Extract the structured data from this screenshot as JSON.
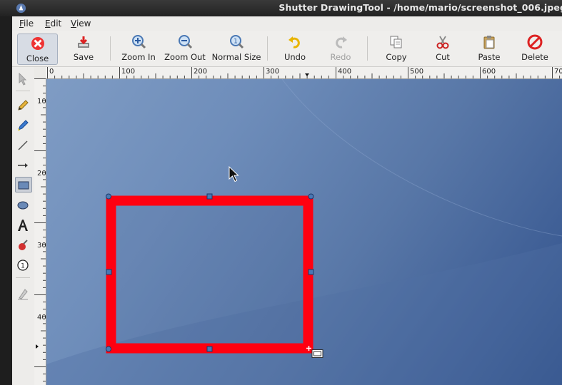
{
  "window": {
    "title": "Shutter DrawingTool - /home/mario/screenshot_006.jpeg"
  },
  "menubar": [
    {
      "label": "File",
      "mnemonic": "F",
      "rest": "ile"
    },
    {
      "label": "Edit",
      "mnemonic": "E",
      "rest": "dit"
    },
    {
      "label": "View",
      "mnemonic": "V",
      "rest": "iew"
    }
  ],
  "toolbar": {
    "close": "Close",
    "save": "Save",
    "zoom_in": "Zoom In",
    "zoom_out": "Zoom Out",
    "normal_size": "Normal Size",
    "undo": "Undo",
    "redo": "Redo",
    "copy": "Copy",
    "cut": "Cut",
    "paste": "Paste",
    "delete": "Delete"
  },
  "toolbox": {
    "tools": [
      "select",
      "freehand",
      "highlighter",
      "line",
      "arrow",
      "rectangle",
      "ellipse",
      "text",
      "censor",
      "number",
      "clear"
    ],
    "active": "rectangle"
  },
  "ruler": {
    "horizontal": [
      "0",
      "100",
      "200",
      "300",
      "400",
      "500",
      "600",
      "70"
    ],
    "vertical": [
      "100",
      "200",
      "300",
      "400"
    ]
  },
  "colors": {
    "rectangle_stroke": "#ff0010",
    "handle_fill": "#4a78b4",
    "canvas_bg": "#6a88b8"
  }
}
